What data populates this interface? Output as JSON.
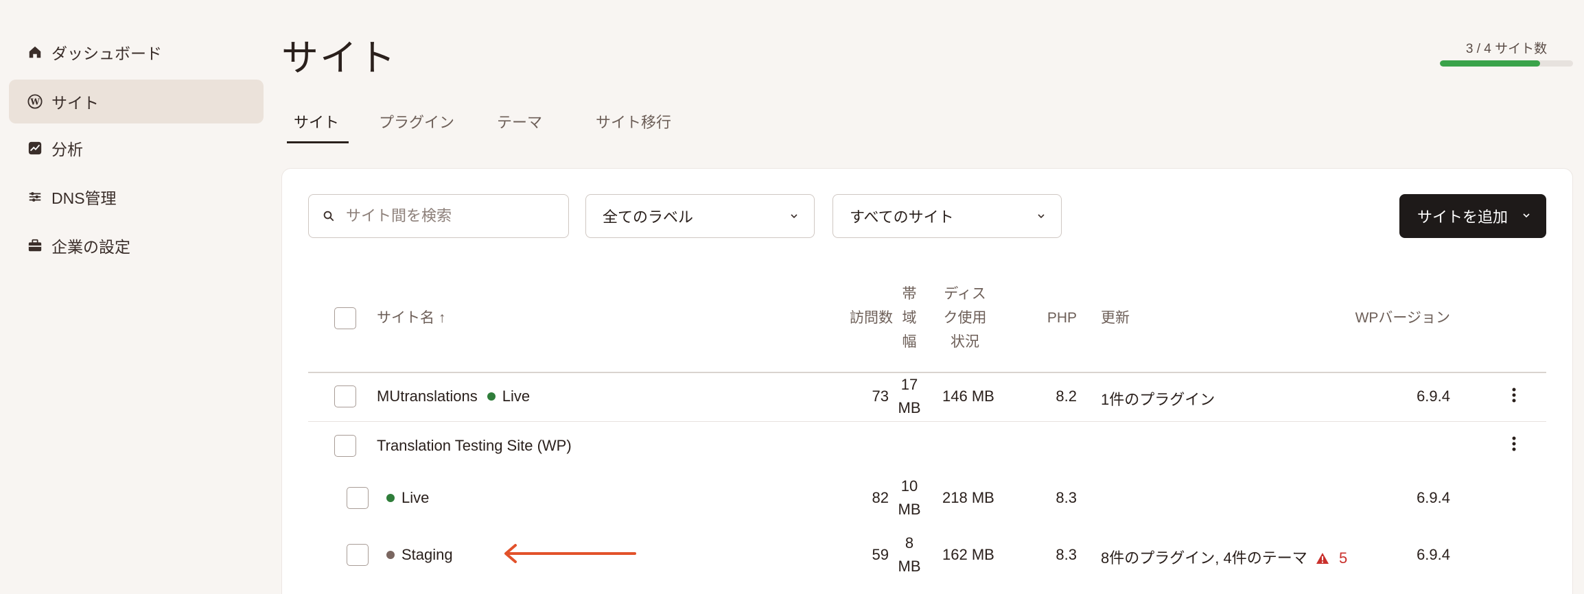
{
  "sidebar": {
    "items": [
      {
        "label": "ダッシュボード",
        "icon": "home-icon"
      },
      {
        "label": "サイト",
        "icon": "wordpress-icon"
      },
      {
        "label": "分析",
        "icon": "analytics-icon"
      },
      {
        "label": "DNS管理",
        "icon": "dns-icon"
      },
      {
        "label": "企業の設定",
        "icon": "briefcase-icon"
      }
    ],
    "active_index": 1
  },
  "header": {
    "title": "サイト",
    "site_count": "3 / 4 サイト数",
    "usage_fraction": 0.75,
    "usage_color": "#3aa34a"
  },
  "tabs": [
    {
      "label": "サイト",
      "active": true
    },
    {
      "label": "プラグイン"
    },
    {
      "label": "テーマ"
    },
    {
      "label": "サイト移行"
    }
  ],
  "toolbar": {
    "search_placeholder": "サイト間を検索",
    "label_filter": "全てのラベル",
    "site_filter": "すべてのサイト",
    "add_button": "サイトを追加"
  },
  "table": {
    "headers": {
      "name": "サイト名 ↑",
      "visits": "訪問数",
      "bandwidth": [
        "帯",
        "域",
        "幅"
      ],
      "disk": [
        "ディス",
        "ク使用",
        "状況"
      ],
      "php": "PHP",
      "updates": "更新",
      "wp": "WPバージョン"
    },
    "rows": [
      {
        "name": "MUtranslations",
        "env": "Live",
        "env_color": "#2f7d3a",
        "visits": "73",
        "bandwidth": [
          "17",
          "MB"
        ],
        "disk": "146 MB",
        "php": "8.2",
        "updates": "1件のプラグイン",
        "wp": "6.9.4"
      },
      {
        "name": "Translation Testing Site (WP)"
      },
      {
        "env": "Live",
        "env_color": "#2f7d3a",
        "visits": "82",
        "bandwidth": [
          "10",
          "MB"
        ],
        "disk": "218 MB",
        "php": "8.3",
        "updates": "",
        "wp": "6.9.4"
      },
      {
        "env": "Staging",
        "env_color": "#7a6660",
        "visits": "59",
        "bandwidth": [
          "8",
          "MB"
        ],
        "disk": "162 MB",
        "php": "8.3",
        "updates": "8件のプラグイン, 4件のテーマ",
        "warning_count": "5",
        "wp": "6.9.4"
      }
    ]
  },
  "colors": {
    "accent_arrow": "#e2522b",
    "warning": "#c9302c"
  }
}
